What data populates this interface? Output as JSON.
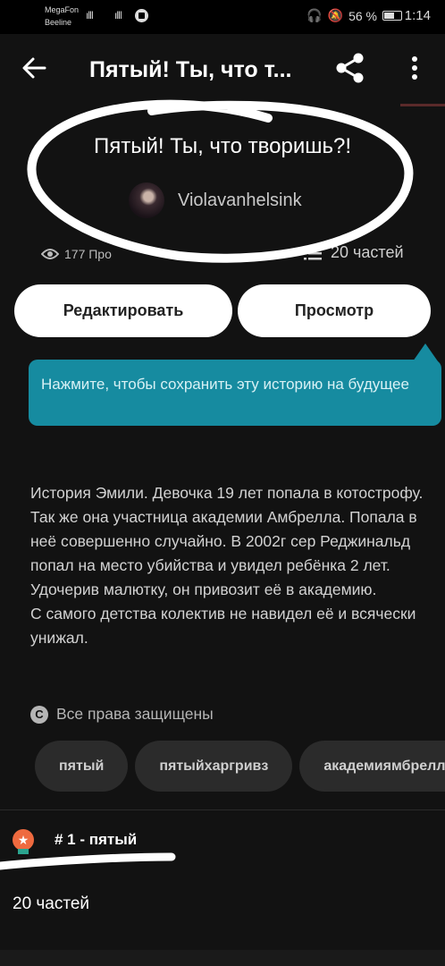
{
  "status_bar": {
    "carrier_1": "MegaFon",
    "carrier_2": "Beeline",
    "signal_1": "4G",
    "signal_2": "",
    "battery": "56 %",
    "time": "1:14",
    "icons": [
      "headphones-icon",
      "mute-icon",
      "alarm-icon",
      "battery-icon"
    ]
  },
  "header": {
    "title": "Пятый! Ты, что т..."
  },
  "story": {
    "title": "Пятый! Ты, что творишь?!",
    "author": "Violavanhelsink",
    "views": "177 Про",
    "parts": "20 частей",
    "edit_label": "Редактировать",
    "preview_label": "Просмотр",
    "save_tooltip": "Нажмите, чтобы сохранить эту историю на будущее",
    "description": "История Эмили. Девочка 19 лет попала в котострофу. Так же она участница академии Амбрелла. Попала в неё совершенно случайно. В 2002г сер Реджинальд попал на место убийства и увидел ребёнка 2 лет. Удочерив малютку, он привозит её в академию.\nС самого детства колектив не навидел её и всячески унижал.",
    "copyright": "Все права защищены",
    "tags": [
      "пятый",
      "пятыйхаргривз",
      "академиямбрелла"
    ]
  },
  "ranking": {
    "badge_icon": "★",
    "label": "# 1 - пятый"
  },
  "parts_section": {
    "label": "20 частей"
  },
  "colors": {
    "background": "#121212",
    "tooltip": "#168ba0",
    "rank_badge": "#ee6a3f",
    "button_bg": "#ffffff"
  }
}
